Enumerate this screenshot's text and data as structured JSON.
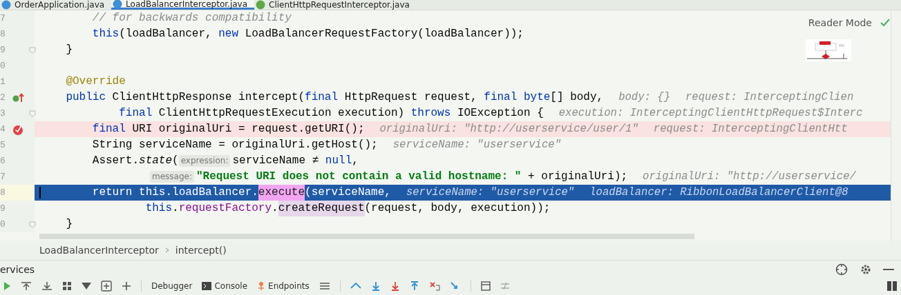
{
  "tabs": [
    {
      "label": "OrderApplication.java",
      "selected": false,
      "kind": "class"
    },
    {
      "label": "LoadBalancerInterceptor.java",
      "selected": true,
      "kind": "class"
    },
    {
      "label": "ClientHttpRequestInterceptor.java",
      "selected": false,
      "kind": "interface"
    }
  ],
  "reader_mode": {
    "label": "Reader Mode"
  },
  "lines": [
    {
      "num": "7",
      "kind": "plain",
      "fold": false,
      "tokens": [
        {
          "kind": "comment",
          "text": "        // for backwards compatibility"
        }
      ]
    },
    {
      "num": "8",
      "kind": "plain",
      "fold": false,
      "tokens": [
        {
          "kind": "kw",
          "text": "        this"
        },
        {
          "kind": "plain",
          "text": "(loadBalancer, "
        },
        {
          "kind": "kw",
          "text": "new"
        },
        {
          "kind": "plain",
          "text": " LoadBalancerRequestFactory(loadBalancer));"
        }
      ]
    },
    {
      "num": "9",
      "kind": "plain",
      "fold": true,
      "tokens": [
        {
          "kind": "plain",
          "text": "    }"
        }
      ]
    },
    {
      "num": "0",
      "kind": "plain",
      "fold": false
    },
    {
      "num": "1",
      "kind": "plain",
      "fold": false,
      "tokens": [
        {
          "kind": "annotation",
          "text": "    @Override"
        }
      ]
    },
    {
      "num": "2",
      "kind": "override",
      "fold": false,
      "tokens": [
        {
          "kind": "kw",
          "text": "    public"
        },
        {
          "kind": "plain",
          "text": " ClientHttpResponse intercept("
        },
        {
          "kind": "kw",
          "text": "final"
        },
        {
          "kind": "plain",
          "text": " HttpRequest request, "
        },
        {
          "kind": "kw",
          "text": "final byte"
        },
        {
          "kind": "plain",
          "text": "[] body,"
        },
        {
          "kind": "hint",
          "text": "body: {}"
        },
        {
          "kind": "hint",
          "text": "request: InterceptingClien"
        }
      ]
    },
    {
      "num": "3",
      "kind": "plain",
      "fold": true,
      "tokens": [
        {
          "kind": "kw",
          "text": "            final"
        },
        {
          "kind": "plain",
          "text": " ClientHttpRequestExecution execution) "
        },
        {
          "kind": "kw",
          "text": "throws"
        },
        {
          "kind": "plain",
          "text": " IOException {"
        },
        {
          "kind": "hint",
          "text": "execution: InterceptingClientHttpRequest$Interc"
        }
      ]
    },
    {
      "num": "4",
      "kind": "breakpoint",
      "fold": false,
      "tokens": [
        {
          "kind": "kw",
          "text": "        final"
        },
        {
          "kind": "plain",
          "text": " URI originalUri = request.getURI();"
        },
        {
          "kind": "hint",
          "text": "originalUri: \"http://userservice/user/1\""
        },
        {
          "kind": "hint",
          "text": "request: InterceptingClientHtt"
        }
      ]
    },
    {
      "num": "5",
      "kind": "plain",
      "fold": false,
      "tokens": [
        {
          "kind": "plain",
          "text": "        String serviceName = originalUri.getHost();"
        },
        {
          "kind": "hint",
          "text": "serviceName: \"userservice\""
        }
      ]
    },
    {
      "num": "6",
      "kind": "plain",
      "fold": false,
      "tokens": [
        {
          "kind": "plain",
          "text": "        Assert."
        },
        {
          "kind": "italic",
          "text": "state"
        },
        {
          "kind": "plain",
          "text": "("
        },
        {
          "kind": "param",
          "text": "expression:"
        },
        {
          "kind": "plain",
          "text": "serviceName ≠ "
        },
        {
          "kind": "kw",
          "text": "null"
        },
        {
          "kind": "plain",
          "text": ","
        }
      ]
    },
    {
      "num": "7",
      "kind": "plain",
      "fold": false,
      "tokens": [
        {
          "kind": "param",
          "text": "message:"
        },
        {
          "kind": "string",
          "text": "\"Request URI does not contain a valid hostname: \""
        },
        {
          "kind": "plain",
          "text": " + originalUri);"
        },
        {
          "kind": "hint",
          "text": "originalUri: \"http://userservice/"
        }
      ]
    },
    {
      "num": "8",
      "kind": "execution",
      "fold": false,
      "tokens": [
        {
          "kind": "kw",
          "text": "        return this"
        },
        {
          "kind": "plain",
          "text": ".loadBalancer."
        },
        {
          "kind": "match",
          "text": "execute"
        },
        {
          "kind": "plain",
          "text": "(serviceName,"
        },
        {
          "kind": "hint",
          "text": "serviceName: \"userservice\""
        },
        {
          "kind": "hint",
          "text": "loadBalancer: RibbonLoadBalancerClient@8"
        }
      ]
    },
    {
      "num": "9",
      "kind": "plain",
      "fold": false,
      "tokens": [
        {
          "kind": "kw",
          "text": "                this"
        },
        {
          "kind": "plain",
          "text": "."
        },
        {
          "kind": "field",
          "text": "requestFactory"
        },
        {
          "kind": "plain",
          "text": "."
        },
        {
          "kind": "usage",
          "text": "createRequest"
        },
        {
          "kind": "plain",
          "text": "(request, body, execution));"
        }
      ]
    },
    {
      "num": "0",
      "kind": "plain",
      "fold": true,
      "tokens": [
        {
          "kind": "plain",
          "text": "    }"
        }
      ]
    }
  ],
  "breadcrumb": [
    "LoadBalancerInterceptor",
    "intercept()"
  ],
  "services": {
    "title": "ervices"
  },
  "bottom_tabs": [
    {
      "label": "Debugger",
      "kind": "plain"
    },
    {
      "label": "Console",
      "kind": "console"
    },
    {
      "label": "Endpoints",
      "kind": "endpoints"
    }
  ]
}
